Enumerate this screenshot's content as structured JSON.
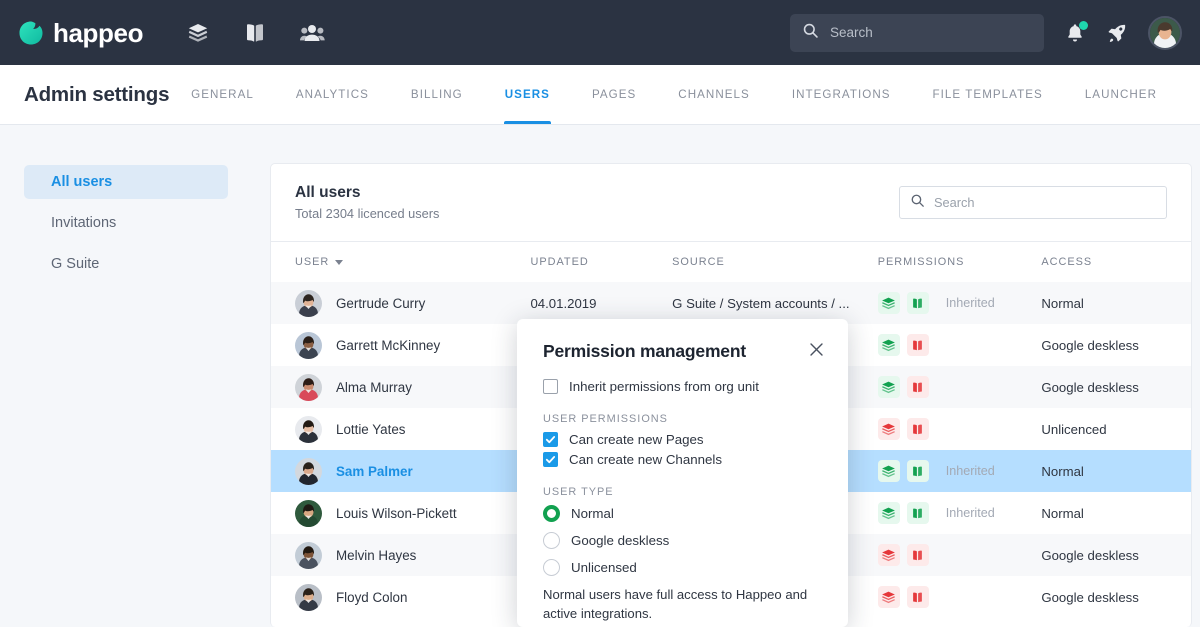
{
  "topbar": {
    "brand_name": "happeo",
    "icons": [
      "pages-layers-icon",
      "channels-book-icon",
      "people-icon"
    ],
    "search": {
      "placeholder": "Search",
      "value": ""
    },
    "notification_icon": "bell-icon",
    "launcher_icon": "rocket-icon",
    "avatar": "user-avatar"
  },
  "subheader": {
    "title": "Admin settings",
    "tabs": [
      {
        "label": "GENERAL",
        "active": false
      },
      {
        "label": "ANALYTICS",
        "active": false
      },
      {
        "label": "BILLING",
        "active": false
      },
      {
        "label": "USERS",
        "active": true
      },
      {
        "label": "PAGES",
        "active": false
      },
      {
        "label": "CHANNELS",
        "active": false
      },
      {
        "label": "INTEGRATIONS",
        "active": false
      },
      {
        "label": "FILE TEMPLATES",
        "active": false
      },
      {
        "label": "LAUNCHER",
        "active": false
      }
    ]
  },
  "sidebar": {
    "items": [
      {
        "label": "All users",
        "active": true
      },
      {
        "label": "Invitations",
        "active": false
      },
      {
        "label": "G Suite",
        "active": false
      }
    ]
  },
  "card": {
    "title": "All users",
    "subtitle": "Total 2304 licenced users",
    "search": {
      "placeholder": "Search",
      "value": ""
    },
    "columns": [
      "USER",
      "UPDATED",
      "SOURCE",
      "PERMISSIONS",
      "ACCESS"
    ],
    "sort_column": "USER",
    "rows": [
      {
        "name": "Gertrude Curry",
        "updated": "04.01.2019",
        "source": "G Suite / System accounts / ...",
        "pages": "green",
        "channels": "green",
        "inherited": "Inherited",
        "access": "Normal",
        "selected": false
      },
      {
        "name": "Garrett McKinney",
        "updated": "",
        "source": "",
        "pages": "green",
        "channels": "red",
        "inherited": "",
        "access": "Google deskless",
        "selected": false
      },
      {
        "name": "Alma Murray",
        "updated": "",
        "source": "",
        "pages": "green",
        "channels": "red",
        "inherited": "",
        "access": "Google deskless",
        "selected": false
      },
      {
        "name": "Lottie Yates",
        "updated": "",
        "source": "",
        "pages": "red",
        "channels": "red",
        "inherited": "",
        "access": "Unlicenced",
        "selected": false
      },
      {
        "name": "Sam Palmer",
        "updated": "",
        "source": "",
        "pages": "green",
        "channels": "green",
        "inherited": "Inherited",
        "access": "Normal",
        "selected": true
      },
      {
        "name": "Louis Wilson-Pickett",
        "updated": "",
        "source": "",
        "pages": "green",
        "channels": "green",
        "inherited": "Inherited",
        "access": "Normal",
        "selected": false
      },
      {
        "name": "Melvin Hayes",
        "updated": "",
        "source": "",
        "pages": "red",
        "channels": "red",
        "inherited": "",
        "access": "Google deskless",
        "selected": false
      },
      {
        "name": "Floyd Colon",
        "updated": "",
        "source": "",
        "pages": "red",
        "channels": "red",
        "inherited": "",
        "access": "Google deskless",
        "selected": false
      }
    ]
  },
  "modal": {
    "title": "Permission management",
    "close_icon": "close-icon",
    "inherit": {
      "label": "Inherit permissions from org unit",
      "checked": false
    },
    "permissions_label": "USER PERMISSIONS",
    "permissions": [
      {
        "label": "Can create new Pages",
        "checked": true
      },
      {
        "label": "Can create new Channels",
        "checked": true
      }
    ],
    "user_type_label": "USER TYPE",
    "user_types": [
      {
        "label": "Normal",
        "selected": true
      },
      {
        "label": "Google deskless",
        "selected": false
      },
      {
        "label": "Unlicensed",
        "selected": false
      }
    ],
    "note": "Normal users have full access to Happeo and active integrations."
  },
  "colors": {
    "brand_teal": "#1fd6ae",
    "accent_blue": "#1a8fe3",
    "topbar_bg": "#2b3342",
    "green": "#12a150",
    "red": "#e5383b",
    "selected_row": "#b5deff"
  }
}
